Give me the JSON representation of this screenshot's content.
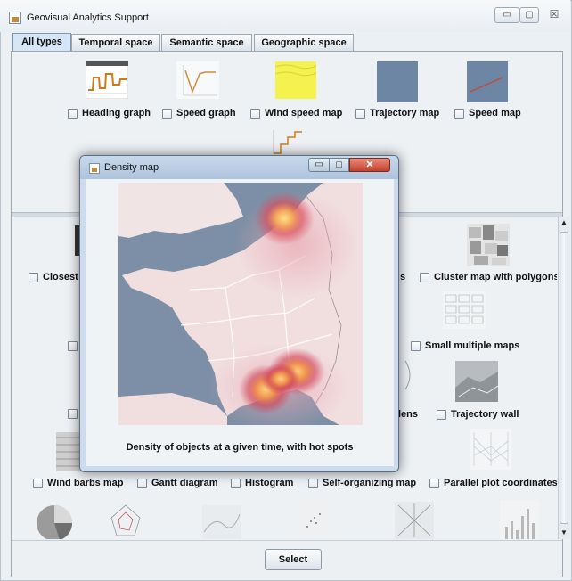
{
  "window": {
    "title": "Geovisual Analytics Support",
    "buttons": {
      "minimize": "▭",
      "maximize": "▢",
      "close": "☒"
    }
  },
  "tabs": [
    {
      "label": "All types",
      "active": true
    },
    {
      "label": "Temporal space",
      "active": false
    },
    {
      "label": "Semantic space",
      "active": false
    },
    {
      "label": "Geographic space",
      "active": false
    }
  ],
  "top_items": [
    {
      "label": "Heading graph",
      "checked": false,
      "icon": "heading-graph-thumbnail"
    },
    {
      "label": "Speed graph",
      "checked": false,
      "icon": "speed-graph-thumbnail"
    },
    {
      "label": "Wind speed map",
      "checked": false,
      "icon": "wind-speed-map-thumbnail"
    },
    {
      "label": "Trajectory map",
      "checked": false,
      "icon": "trajectory-map-thumbnail"
    },
    {
      "label": "Speed map",
      "checked": false,
      "icon": "speed-map-thumbnail"
    }
  ],
  "lower_items": {
    "row1": [
      {
        "label": "Closest",
        "checked": false
      },
      {
        "label": "s",
        "checked": false
      },
      {
        "label": "Cluster map with polygons",
        "checked": false
      }
    ],
    "row2": [
      {
        "label": "Small multiple maps",
        "checked": false
      }
    ],
    "row3": [
      {
        "label": "lens",
        "checked": false
      },
      {
        "label": "Trajectory wall",
        "checked": false
      }
    ],
    "row4": [
      {
        "label": "Wind barbs map",
        "checked": false
      },
      {
        "label": "Gantt diagram",
        "checked": false
      },
      {
        "label": "Histogram",
        "checked": false
      },
      {
        "label": "Self-organizing map",
        "checked": false
      },
      {
        "label": "Parallel plot coordinates",
        "checked": false
      }
    ]
  },
  "scroll": {
    "up_arrow": "▲",
    "down_arrow": "▼"
  },
  "select_button": "Select",
  "density_window": {
    "title": "Density map",
    "buttons": {
      "minimize": "▭",
      "maximize": "▢",
      "close": "✕"
    },
    "caption": "Density of objects at a given time, with hot spots",
    "map_icon": "density-heatmap-france"
  },
  "colors": {
    "tab_active": "#d6e6f6",
    "heat_core": "#f4c66a",
    "heat_glow": "#d9485a",
    "sea": "#7c8fa6",
    "land": "#f1dfe0"
  }
}
